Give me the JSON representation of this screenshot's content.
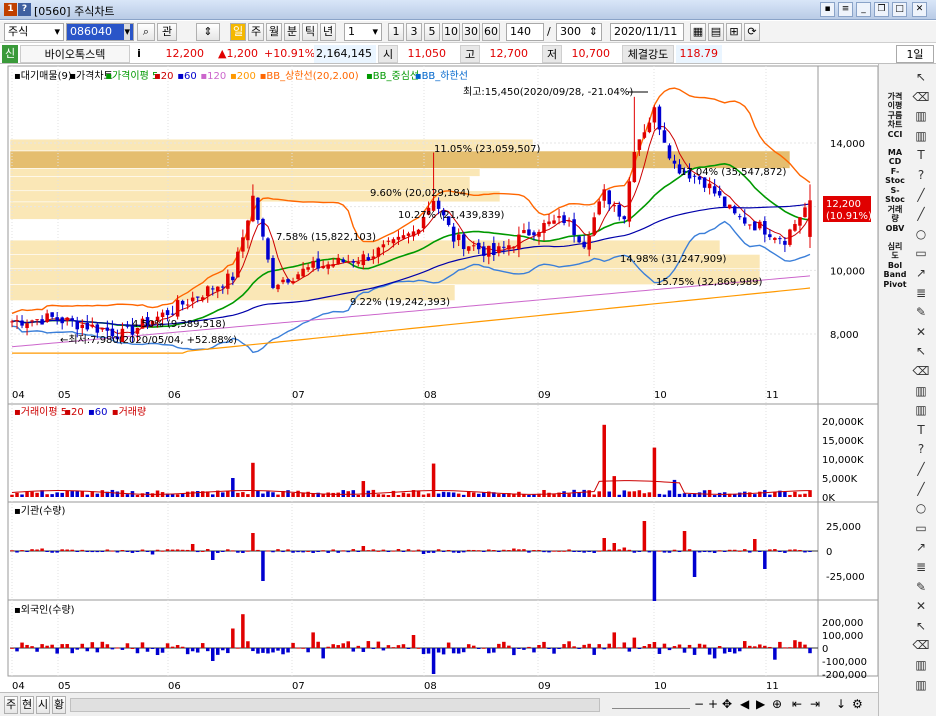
{
  "window": {
    "title": "[0560] 주식차트",
    "period_btn": "1일"
  },
  "toolbar1": {
    "market": "주식",
    "code": "086040",
    "buttons": [
      "관",
      "일",
      "주",
      "월",
      "분",
      "틱",
      "년"
    ],
    "count_sel": "1",
    "intervals": [
      "1",
      "3",
      "5",
      "10",
      "30",
      "60"
    ],
    "display_count": "140",
    "slash": "/",
    "total_count": "300",
    "date": "2020/11/11"
  },
  "quote": {
    "badge": "신",
    "name": "바이오톡스텍",
    "info_icon": "i",
    "price": "12,200",
    "change": "▲1,200",
    "rate": "+10.91%",
    "volume": "2,164,145",
    "open_label": "시",
    "open": "11,050",
    "high_label": "고",
    "high": "12,700",
    "low_label": "저",
    "low": "10,700",
    "strength_label": "체결강도",
    "strength": "118.79"
  },
  "legend": {
    "main": [
      {
        "text": "▪대기매물(9)",
        "color": "#000000"
      },
      {
        "text": "▪가격차트",
        "color": "#000000"
      },
      {
        "text": "▪가격이평 5",
        "color": "#009900"
      },
      {
        "text": "▪20",
        "color": "#cc0000"
      },
      {
        "text": "▪60",
        "color": "#0000cc"
      },
      {
        "text": "▪120",
        "color": "#cc66cc"
      },
      {
        "text": "▪200",
        "color": "#ff9900"
      },
      {
        "text": "▪BB_상한선(20,2.00)",
        "color": "#ff6600"
      },
      {
        "text": "▪BB_중심선",
        "color": "#009900"
      },
      {
        "text": "▪BB_하한선",
        "color": "#0066cc"
      }
    ],
    "volume": [
      {
        "text": "▪거래이평 5",
        "color": "#cc0000"
      },
      {
        "text": "▪20",
        "color": "#cc0000"
      },
      {
        "text": "▪60",
        "color": "#0000cc"
      },
      {
        "text": "▪거래량",
        "color": "#cc0000"
      }
    ],
    "inst": "▪기관(수량)",
    "foreign": "▪외국인(수량)"
  },
  "annotations": {
    "high": "최고:15,450(2020/09/28, -21.04%)",
    "low": "←최저:7,980(2020/05/04, +52.88%)"
  },
  "supply_labels": [
    "11.05% (23,059,507)",
    "17.04% (35,547,872)",
    "9.60% (20,029,184)",
    "10.27% (21,439,839)",
    "7.58% (15,822,103)",
    "14.98% (31,247,909)",
    "15.75% (32,869,989)",
    "9.22% (19,242,393)",
    "4.50% (9,389,518)"
  ],
  "current_price_tag": {
    "price": "12,200",
    "rate": "(10.91%)"
  },
  "price_axis": [
    "14,000",
    "12,000",
    "10,000",
    "8,000"
  ],
  "volume_axis": [
    "20,000K",
    "15,000K",
    "10,000K",
    "5,000K",
    "0K"
  ],
  "inst_axis": [
    "25,000",
    "0",
    "-25,000"
  ],
  "foreign_axis": [
    "200,000",
    "100,000",
    "0",
    "-100,000",
    "-200,000"
  ],
  "months": [
    "04",
    "05",
    "06",
    "07",
    "08",
    "09",
    "10",
    "11"
  ],
  "bottom_tabs": [
    "주",
    "현",
    "시",
    "황"
  ],
  "rightbar": {
    "labels": [
      "가격\n이평",
      "구름\n차트",
      "CCI",
      "MA\nCD",
      "F-\nStoc",
      "S-\nStoc",
      "거래\n량",
      "OBV",
      "심리\n도",
      "Bol\nBand",
      "Pivot"
    ],
    "icons": [
      "cursor-icon",
      "eraser-icon",
      "chart-icon",
      "chart-icon",
      "text-icon",
      "question-icon",
      "line-icon",
      "line-icon",
      "circle-icon",
      "rect-icon",
      "arrow-icon",
      "fib-icon",
      "pencil-icon",
      "delete-icon"
    ]
  },
  "colors": {
    "up": "#e00000",
    "down": "#0000d0",
    "bb_upper": "#ff6600",
    "bb_mid": "#009900",
    "bb_lower": "#3b7fd9",
    "ma20": "#cc0000",
    "ma60": "#0000aa",
    "ma120": "#cc66cc",
    "ma200": "#ff9900",
    "supply": "#f5d37a"
  }
}
